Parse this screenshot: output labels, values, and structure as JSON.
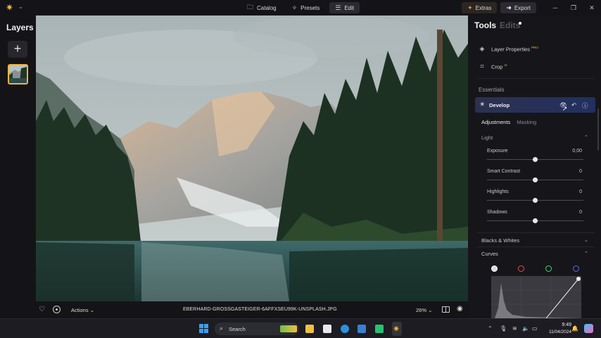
{
  "topbar": {
    "nav": [
      {
        "label": "Catalog",
        "icon": "folder-icon",
        "active": false
      },
      {
        "label": "Presets",
        "icon": "presets-icon",
        "active": false
      },
      {
        "label": "Edit",
        "icon": "edit-icon",
        "active": true
      }
    ],
    "extras_label": "Extras",
    "export_label": "Export"
  },
  "layers": {
    "title": "Layers",
    "add_label": "+"
  },
  "bottombar": {
    "actions_label": "Actions",
    "filename": "EBERHARD-GROSSGASTEIGER-6AFFXSEU99K-UNSPLASH.JPG",
    "zoom": "26%"
  },
  "panel": {
    "tab_tools": "Tools",
    "tab_edits": "Edits",
    "layer_properties": "Layer Properties",
    "layer_properties_badge": "PRO",
    "crop": "Crop",
    "crop_badge": "AI",
    "essentials": "Essentials",
    "develop": "Develop",
    "subtab_adjustments": "Adjustments",
    "subtab_masking": "Masking",
    "group_light": "Light",
    "sliders": [
      {
        "label": "Exposure",
        "value": "0,00",
        "position": 0.5
      },
      {
        "label": "Smart Contrast",
        "value": "0",
        "position": 0.5
      },
      {
        "label": "Highlights",
        "value": "0",
        "position": 0.5
      },
      {
        "label": "Shadows",
        "value": "0",
        "position": 0.5
      }
    ],
    "group_blacks_whites": "Blacks & Whites",
    "group_curves": "Curves",
    "curve_channels": [
      {
        "name": "luminance",
        "color": "#ffffff"
      },
      {
        "name": "red",
        "color": "#e84a4a"
      },
      {
        "name": "green",
        "color": "#4ad86a"
      },
      {
        "name": "blue",
        "color": "#5a6af0"
      }
    ]
  },
  "taskbar": {
    "search_label": "Search",
    "time": "9:49",
    "date": "11/04/2024"
  },
  "colors": {
    "accent": "#f0b53a",
    "develop_bg": "#223060",
    "panel_bg": "#16161a"
  }
}
